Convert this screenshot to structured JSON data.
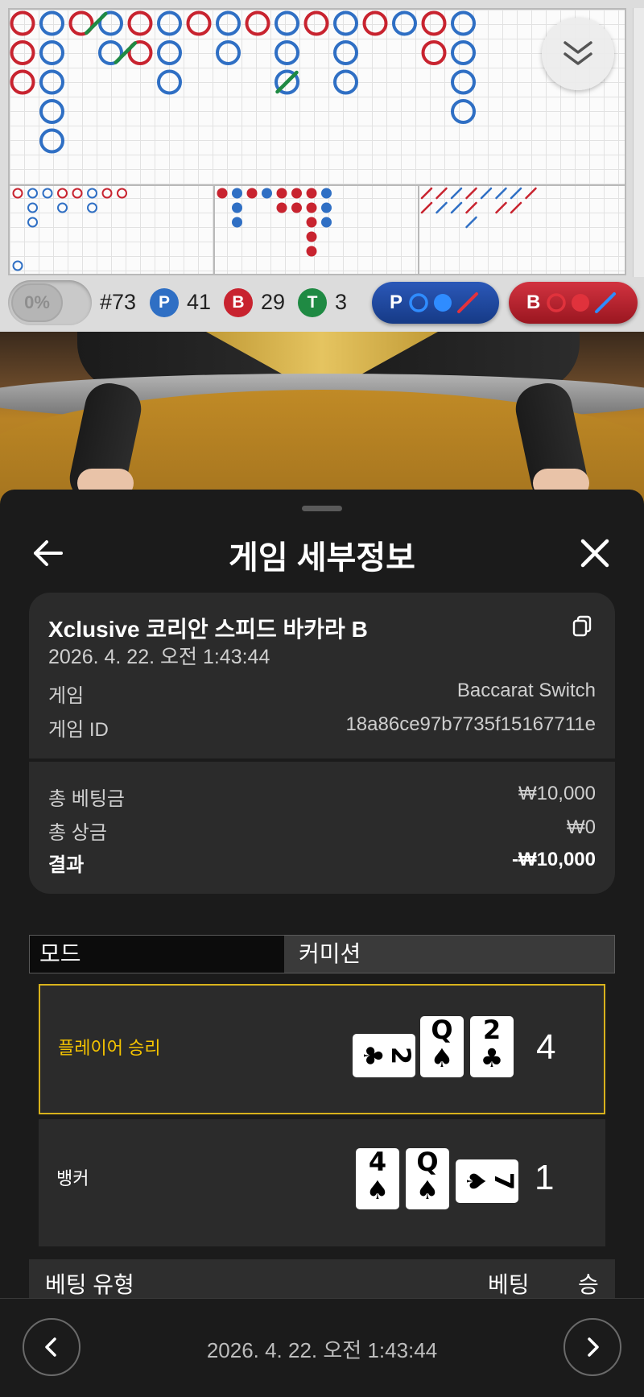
{
  "roadmap": {
    "round_label": "#73",
    "percent_label": "0%",
    "player_badge": "P",
    "player_count": "41",
    "banker_badge": "B",
    "banker_count": "29",
    "tie_badge": "T",
    "tie_count": "3",
    "player_predict_label": "P",
    "banker_predict_label": "B",
    "colors": {
      "player": "#2f6fc4",
      "banker": "#c8232f",
      "tie": "#1f8a43"
    }
  },
  "sheet": {
    "title": "게임 세부정보",
    "game_name": "Xclusive 코리안 스피드 바카라 B",
    "game_time": "2026. 4. 22. 오전 1:43:44",
    "game_label": "게임",
    "game_value": "Baccarat Switch",
    "game_id_label": "게임 ID",
    "game_id_value": "18a86ce97b7735f15167711e",
    "total_bet_label": "총 베팅금",
    "total_bet_value": "₩10,000",
    "total_win_label": "총 상금",
    "total_win_value": "₩0",
    "result_label": "결과",
    "result_value": "-₩10,000",
    "tab_mode": "모드",
    "tab_commission": "커미션",
    "player_label": "플레이어 승리",
    "player_score": "4",
    "player_cards": [
      {
        "rank": "2",
        "suit": "♣",
        "rotated": true
      },
      {
        "rank": "Q",
        "suit": "♠",
        "rotated": false
      },
      {
        "rank": "2",
        "suit": "♣",
        "rotated": false
      }
    ],
    "banker_label": "뱅커",
    "banker_score": "1",
    "banker_cards": [
      {
        "rank": "4",
        "suit": "♠",
        "rotated": false
      },
      {
        "rank": "Q",
        "suit": "♠",
        "rotated": false
      },
      {
        "rank": "7",
        "suit": "♠",
        "rotated": true
      }
    ],
    "bet_type_header": "베팅 유형",
    "bet_amount_header": "베팅",
    "bet_win_header": "승",
    "footer_time": "2026. 4. 22. 오전 1:43:44"
  },
  "colors": {
    "accent_gold": "#d8b21c",
    "player_label_color": "#f5c400",
    "sheet_bg": "#1b1b1b",
    "card_bg": "#2b2b2b"
  }
}
